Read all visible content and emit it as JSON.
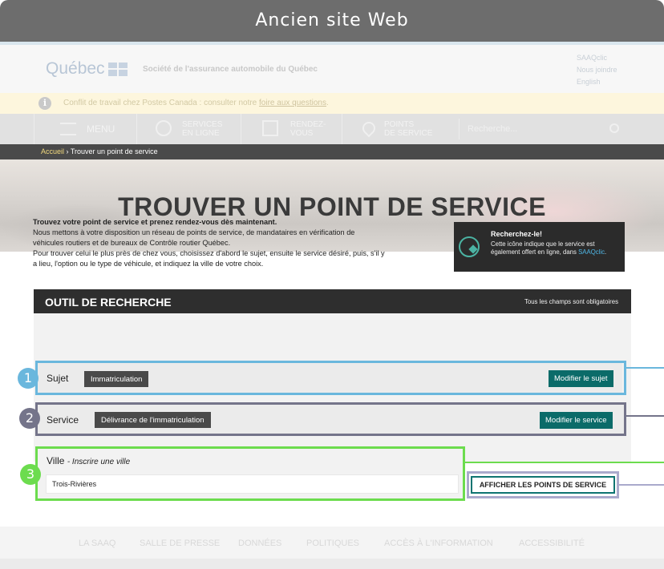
{
  "banner": {
    "title": "Ancien site Web"
  },
  "header": {
    "logo_text": "Québec",
    "org_name": "Société de l'assurance automobile du Québec",
    "links": [
      "SAAQclic",
      "Nous joindre",
      "English"
    ]
  },
  "alert": {
    "text": "Conflit de travail chez Postes Canada : consulter notre ",
    "link": "foire aux questions",
    "end": "."
  },
  "nav": {
    "menu": "MENU",
    "services": [
      "SERVICES",
      "EN LIGNE"
    ],
    "rdv": [
      "RENDEZ-",
      "VOUS"
    ],
    "points": [
      "POINTS",
      "DE SERVICE"
    ],
    "search_placeholder": "Recherche..."
  },
  "breadcrumb": {
    "home": "Accueil",
    "sep": "›",
    "current": "Trouver un point de service"
  },
  "hero": {
    "title": "TROUVER UN POINT DE SERVICE"
  },
  "intro": {
    "lead": "Trouvez votre point de service et prenez rendez-vous dès maintenant.",
    "lines": [
      "Nous mettons à votre disposition un réseau de points de service, de mandataires en vérification de",
      "véhicules routiers et de bureaux de Contrôle routier Québec.",
      "Pour trouver celui le plus près de chez vous, choisissez d'abord le sujet, ensuite le service désiré, puis, s'il y",
      "a lieu, l'option ou le type de véhicule, et indiquez la ville de votre choix."
    ]
  },
  "promo": {
    "title": "Recherchez-le!",
    "text": "Cette icône indique que le service est également offert en ligne, dans ",
    "link": "SAAQclic",
    "end": "."
  },
  "tool": {
    "title": "OUTIL DE RECHERCHE",
    "required_note": "Tous les champs sont obligatoires",
    "subject": {
      "label": "Sujet",
      "value": "Immatriculation",
      "button": "Modifier le sujet"
    },
    "service": {
      "label": "Service",
      "value": "Délivrance de l'immatriculation",
      "button": "Modifier le service"
    },
    "city": {
      "label": "Ville",
      "hint": "- Inscrire une ville",
      "value": "Trois-Rivières",
      "button": "AFFICHER LES POINTS DE SERVICE"
    }
  },
  "callouts": [
    {
      "number": "1",
      "color": "#6ab7dd"
    },
    {
      "number": "2",
      "color": "#74748a"
    },
    {
      "number": "3",
      "color": "#6cdc4e"
    }
  ],
  "footer": {
    "links": [
      "LA SAAQ",
      "SALLE DE PRESSE",
      "DONNÉES",
      "POLITIQUES",
      "ACCÈS À L'INFORMATION",
      "ACCESSIBILITÉ"
    ]
  }
}
